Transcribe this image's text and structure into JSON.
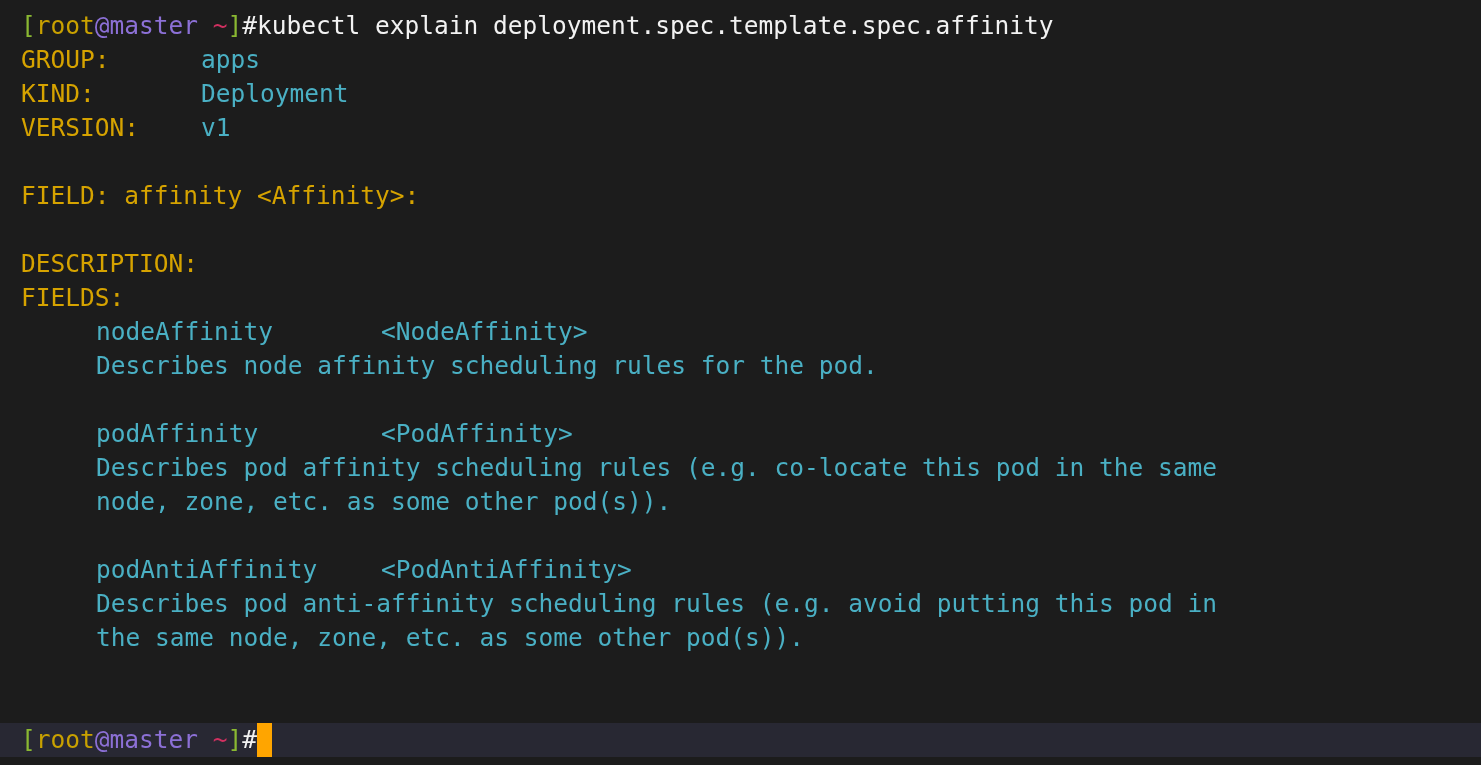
{
  "terminal": {
    "lines": [
      {
        "kind": "prompt",
        "segments": [
          {
            "text": "[",
            "kind": "bracket"
          },
          {
            "text": "root",
            "kind": "user"
          },
          {
            "text": "@master",
            "kind": "host"
          },
          {
            "text": " ~",
            "kind": "cwd"
          },
          {
            "text": "]",
            "kind": "bracket"
          },
          {
            "text": "#",
            "kind": "symbol"
          },
          {
            "text": "kubectl explain deployment.spec.template.spec.affinity",
            "kind": "command"
          }
        ]
      },
      {
        "kind": "meta",
        "label": "GROUP:",
        "value": "apps"
      },
      {
        "kind": "meta",
        "label": "KIND:",
        "value": "Deployment"
      },
      {
        "kind": "meta",
        "label": "VERSION:",
        "value": "v1"
      },
      {
        "kind": "blank"
      },
      {
        "kind": "heading",
        "text": "FIELD: affinity <Affinity>:"
      },
      {
        "kind": "blank"
      },
      {
        "kind": "heading",
        "text": "DESCRIPTION:"
      },
      {
        "kind": "heading",
        "text": "FIELDS:"
      },
      {
        "kind": "entry",
        "name": "nodeAffinity",
        "type": "<NodeAffinity>"
      },
      {
        "kind": "desc",
        "text": "Describes node affinity scheduling rules for the pod."
      },
      {
        "kind": "blank"
      },
      {
        "kind": "entry",
        "name": "podAffinity",
        "type": "<PodAffinity>"
      },
      {
        "kind": "desc",
        "text": "Describes pod affinity scheduling rules (e.g. co-locate this pod in the same"
      },
      {
        "kind": "desc",
        "text": "node, zone, etc. as some other pod(s))."
      },
      {
        "kind": "blank"
      },
      {
        "kind": "entry",
        "name": "podAntiAffinity",
        "type": "<PodAntiAffinity>"
      },
      {
        "kind": "desc",
        "text": "Describes pod anti-affinity scheduling rules (e.g. avoid putting this pod in"
      },
      {
        "kind": "desc",
        "text": "the same node, zone, etc. as some other pod(s))."
      },
      {
        "kind": "blank"
      },
      {
        "kind": "blank"
      },
      {
        "kind": "active_prompt",
        "segments": [
          {
            "text": "[",
            "kind": "bracket"
          },
          {
            "text": "root",
            "kind": "user"
          },
          {
            "text": "@master",
            "kind": "host"
          },
          {
            "text": " ~",
            "kind": "cwd"
          },
          {
            "text": "]",
            "kind": "bracket"
          },
          {
            "text": "#",
            "kind": "symbol"
          }
        ]
      }
    ]
  }
}
